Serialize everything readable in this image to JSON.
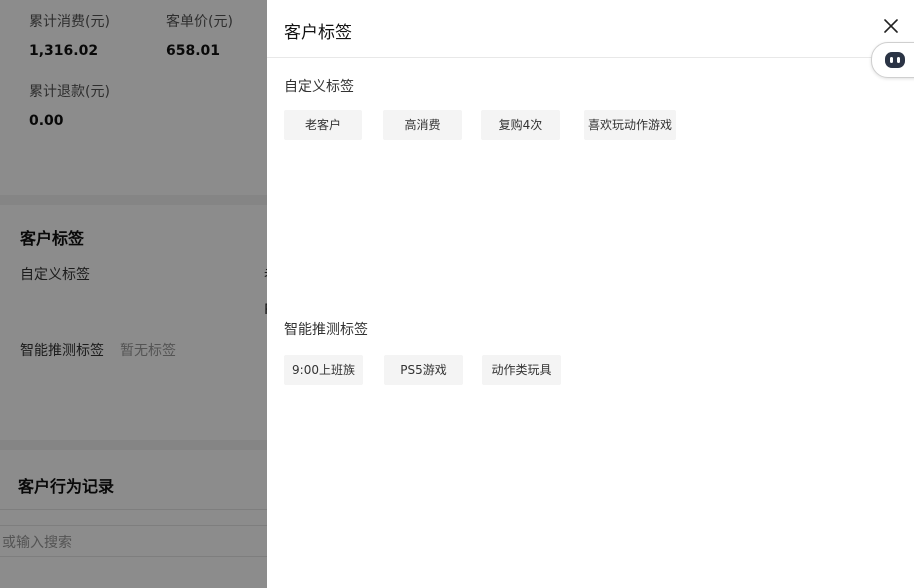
{
  "background_page": {
    "stats": [
      {
        "label": "累计消费(元)",
        "value": "1,316.02"
      },
      {
        "label": "客单价(元)",
        "value": "658.01"
      },
      {
        "label": "累计退款(元)",
        "value": "0.00"
      }
    ],
    "tags_section_title": "客户标签",
    "custom_tags_label": "自定义标签",
    "smart_tags_label": "智能推测标签",
    "smart_tags_empty": "暂无标签",
    "behavior_title": "客户行为记录",
    "search_placeholder": "或输入搜索",
    "cut_chars": [
      "老",
      "P"
    ]
  },
  "drawer": {
    "title": "客户标签",
    "custom_group_title": "自定义标签",
    "custom_tags": [
      "老客户",
      "高消费",
      "复购4次",
      "喜欢玩动作游戏"
    ],
    "smart_group_title": "智能推测标签",
    "smart_tags": [
      "9:00上班族",
      "PS5游戏",
      "动作类玩具"
    ]
  },
  "icons": {
    "close": "close-icon",
    "robot": "robot-icon"
  }
}
